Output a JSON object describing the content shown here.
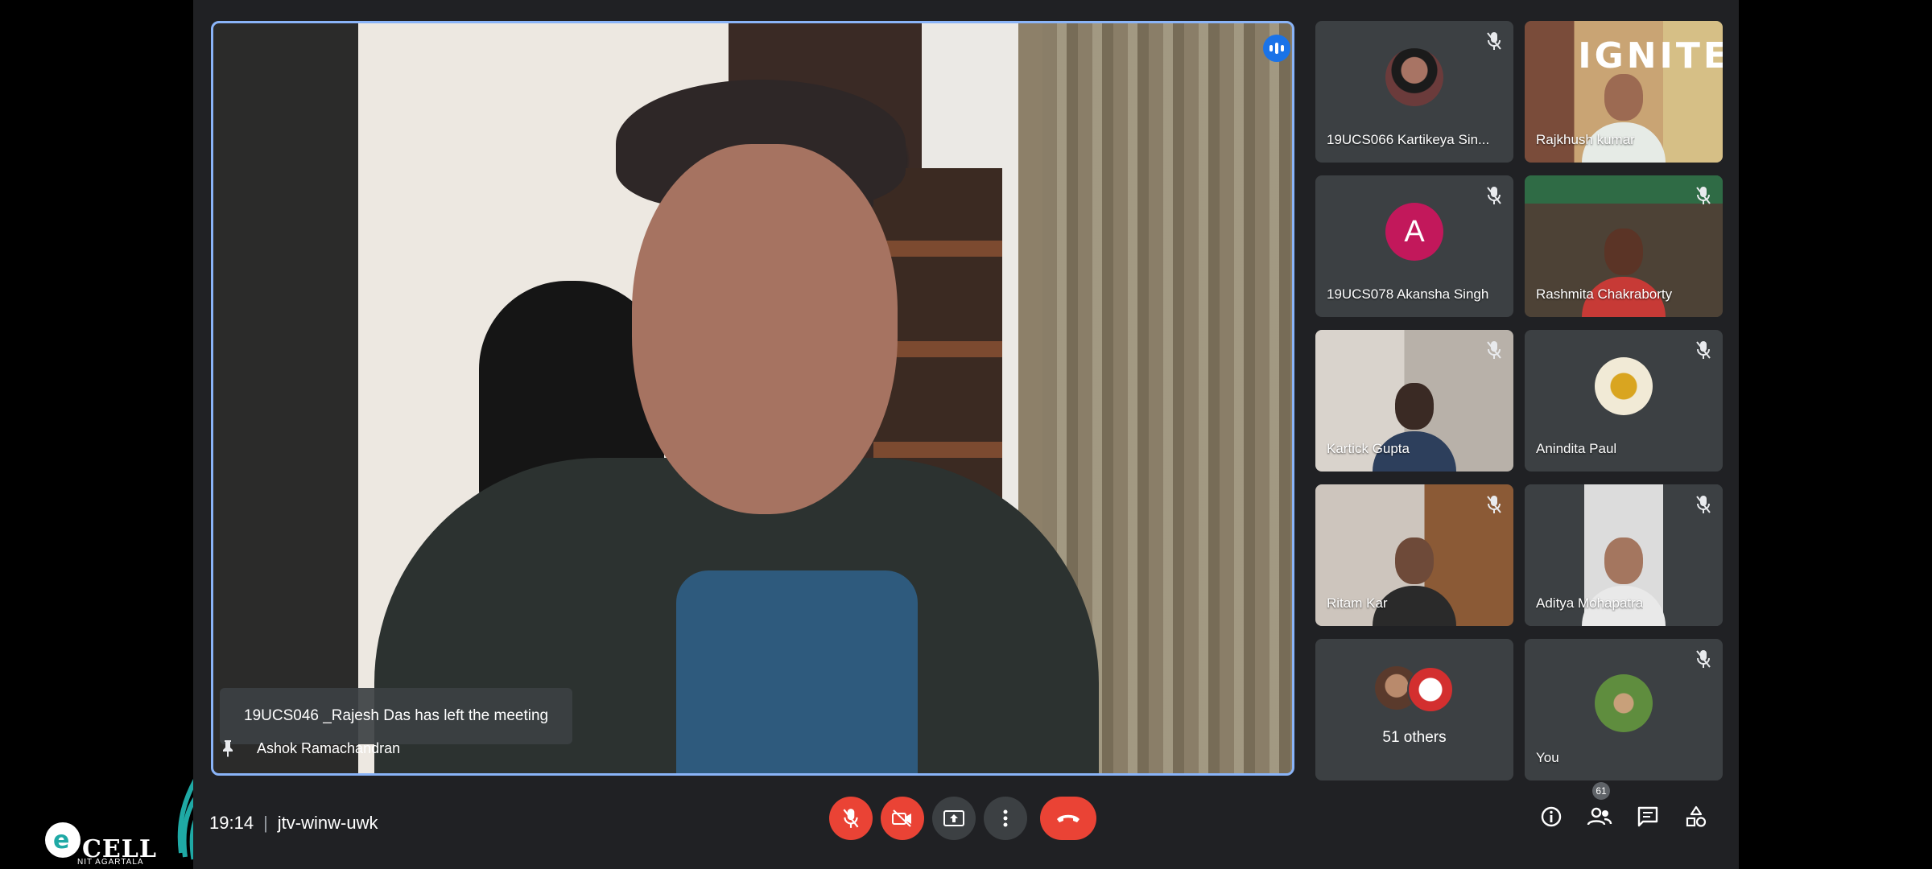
{
  "main_speaker": {
    "name": "Ashok Ramachandran",
    "notification": "19UCS046 _Rajesh Das has left the meeting"
  },
  "participants": [
    {
      "name": "19UCS066 Kartikeya Sin...",
      "muted": true,
      "type": "photo-avatar"
    },
    {
      "name": "Rajkhush kumar",
      "muted": false,
      "type": "video",
      "overlay": "IGNITE"
    },
    {
      "name": "19UCS078 Akansha Singh",
      "muted": true,
      "type": "letter-avatar",
      "letter": "A",
      "color": "#c2185b"
    },
    {
      "name": "Rashmita Chakraborty",
      "muted": true,
      "type": "video"
    },
    {
      "name": "Kartick Gupta",
      "muted": true,
      "type": "video"
    },
    {
      "name": "Anindita Paul",
      "muted": true,
      "type": "photo-avatar"
    },
    {
      "name": "Ritam Kar",
      "muted": true,
      "type": "video"
    },
    {
      "name": "Aditya Mohapatra",
      "muted": true,
      "type": "video"
    },
    {
      "name": "51 others",
      "muted": false,
      "type": "others"
    },
    {
      "name": "You",
      "muted": true,
      "type": "photo-avatar"
    }
  ],
  "bottom_bar": {
    "time": "19:14",
    "meeting_code": "jtv-winw-uwk",
    "people_count": "61",
    "controls": [
      "mic-off",
      "camera-off",
      "present",
      "more",
      "end-call"
    ],
    "side_controls": [
      "info",
      "people",
      "chat",
      "activities"
    ]
  },
  "watermark": {
    "brand": "CELL",
    "sub": "NIT AGARTALA"
  },
  "colors": {
    "background": "#202124",
    "tile": "#3c4043",
    "danger": "#ea4335",
    "active_border": "#8ab4f8"
  }
}
